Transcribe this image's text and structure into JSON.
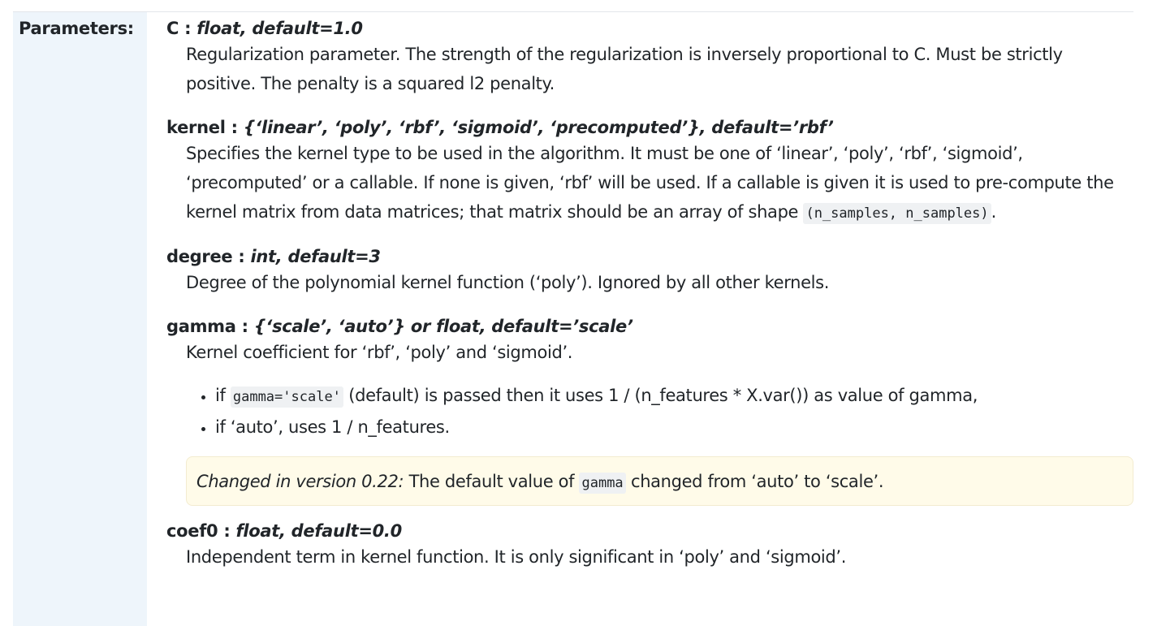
{
  "field_label": "Parameters:",
  "params": {
    "C": {
      "name": "C",
      "sep": " : ",
      "type": "float, default=1.0",
      "desc": "Regularization parameter. The strength of the regularization is inversely proportional to C. Must be strictly positive. The penalty is a squared l2 penalty."
    },
    "kernel": {
      "name": "kernel",
      "sep": " : ",
      "type": "{‘linear’, ‘poly’, ‘rbf’, ‘sigmoid’, ‘precomputed’}, default=’rbf’",
      "desc_pre": "Specifies the kernel type to be used in the algorithm. It must be one of ‘linear’, ‘poly’, ‘rbf’, ‘sigmoid’, ‘precomputed’ or a callable. If none is given, ‘rbf’ will be used. If a callable is given it is used to pre-compute the kernel matrix from data matrices; that matrix should be an array of shape ",
      "desc_code": "(n_samples, n_samples)",
      "desc_post": "."
    },
    "degree": {
      "name": "degree",
      "sep": " : ",
      "type": "int, default=3",
      "desc": "Degree of the polynomial kernel function (‘poly’). Ignored by all other kernels."
    },
    "gamma": {
      "name": "gamma",
      "sep": " : ",
      "type": "{‘scale’, ‘auto’} or float, default=’scale’",
      "desc": "Kernel coefficient for ‘rbf’, ‘poly’ and ‘sigmoid’.",
      "bullet1_pre": "if ",
      "bullet1_code": "gamma='scale'",
      "bullet1_post": " (default) is passed then it uses 1 / (n_features * X.var()) as value of gamma,",
      "bullet2": "if ‘auto’, uses 1 / n_features.",
      "version_tag": "Changed in version 0.22:",
      "version_pre": " The default value of ",
      "version_code": "gamma",
      "version_post": " changed from ‘auto’ to ‘scale’."
    },
    "coef0": {
      "name": "coef0",
      "sep": " : ",
      "type": "float, default=0.0",
      "desc": "Independent term in kernel function. It is only significant in ‘poly’ and ‘sigmoid’."
    }
  }
}
